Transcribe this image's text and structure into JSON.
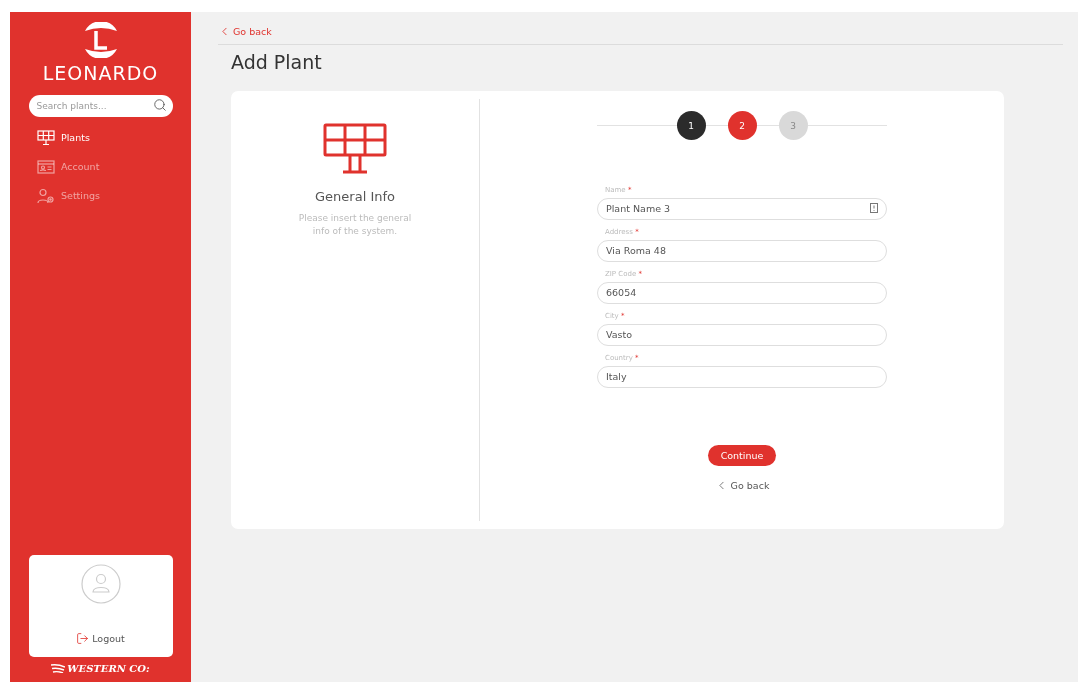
{
  "sidebar": {
    "brand": "LEONARDO",
    "search": {
      "placeholder": "Search plants..."
    },
    "items": [
      {
        "label": "Plants",
        "selected": true
      },
      {
        "label": "Account",
        "selected": false
      },
      {
        "label": "Settings",
        "selected": false
      }
    ],
    "logout": "Logout",
    "footer": "WESTERN CO:"
  },
  "back_link": "Go back",
  "title": "Add Plant",
  "intro": {
    "heading": "General Info",
    "text": "Please insert the general info of the system."
  },
  "steps": [
    {
      "label": "1",
      "completed": true,
      "selected": false
    },
    {
      "label": "2",
      "completed": false,
      "selected": true
    },
    {
      "label": "3",
      "completed": false,
      "selected": false
    }
  ],
  "fields": [
    {
      "label": "Name",
      "required_mark": "*",
      "value": "Plant Name 3",
      "has_icon": true
    },
    {
      "label": "Address",
      "required_mark": "*",
      "value": "Via Roma 48",
      "has_icon": false
    },
    {
      "label": "ZIP Code",
      "required_mark": "*",
      "value": "66054",
      "has_icon": false
    },
    {
      "label": "City",
      "required_mark": "*",
      "value": "Vasto",
      "has_icon": false
    },
    {
      "label": "Country",
      "required_mark": "*",
      "value": "Italy",
      "has_icon": false
    }
  ],
  "continue_button": "Continue",
  "bottom_back_link": "Go back"
}
